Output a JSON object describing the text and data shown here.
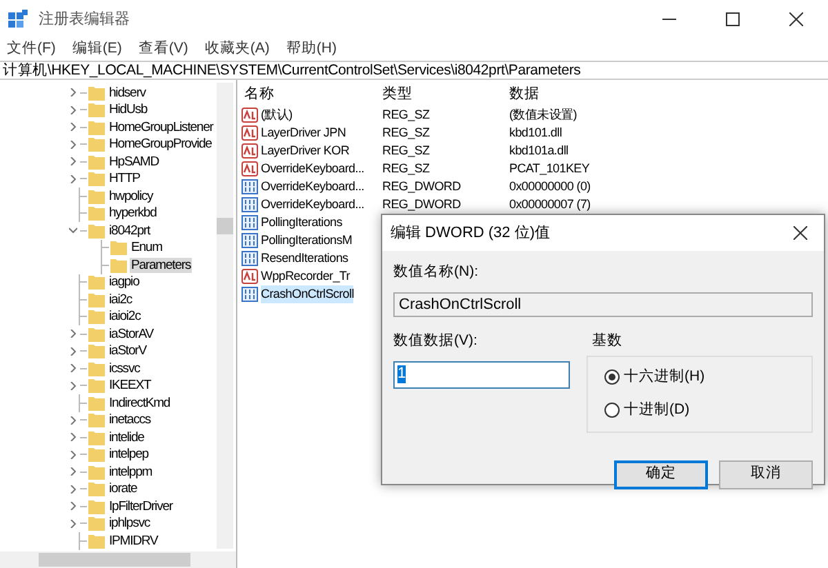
{
  "window": {
    "title": "注册表编辑器"
  },
  "menu": [
    "文件(F)",
    "编辑(E)",
    "查看(V)",
    "收藏夹(A)",
    "帮助(H)"
  ],
  "address": "计算机\\HKEY_LOCAL_MACHINE\\SYSTEM\\CurrentControlSet\\Services\\i8042prt\\Parameters",
  "tree": [
    {
      "label": "hidserv",
      "kind": "collapsed",
      "selected": false
    },
    {
      "label": "HidUsb",
      "kind": "collapsed",
      "selected": false
    },
    {
      "label": "HomeGroupListener",
      "kind": "collapsed",
      "selected": false
    },
    {
      "label": "HomeGroupProvide",
      "kind": "collapsed",
      "selected": false
    },
    {
      "label": "HpSAMD",
      "kind": "collapsed",
      "selected": false
    },
    {
      "label": "HTTP",
      "kind": "collapsed",
      "selected": false
    },
    {
      "label": "hwpolicy",
      "kind": "leaf",
      "selected": false
    },
    {
      "label": "hyperkbd",
      "kind": "leaf",
      "selected": false
    },
    {
      "label": "i8042prt",
      "kind": "expanded",
      "selected": false,
      "children": [
        {
          "label": "Enum",
          "kind": "leaf",
          "selected": false
        },
        {
          "label": "Parameters",
          "kind": "leaf",
          "selected": true
        }
      ]
    },
    {
      "label": "iagpio",
      "kind": "leaf",
      "selected": false
    },
    {
      "label": "iai2c",
      "kind": "leaf",
      "selected": false
    },
    {
      "label": "iaioi2c",
      "kind": "leaf",
      "selected": false
    },
    {
      "label": "iaStorAV",
      "kind": "collapsed",
      "selected": false
    },
    {
      "label": "iaStorV",
      "kind": "collapsed",
      "selected": false
    },
    {
      "label": "icssvc",
      "kind": "collapsed",
      "selected": false
    },
    {
      "label": "IKEEXT",
      "kind": "collapsed",
      "selected": false
    },
    {
      "label": "IndirectKmd",
      "kind": "leaf",
      "selected": false
    },
    {
      "label": "inetaccs",
      "kind": "collapsed",
      "selected": false
    },
    {
      "label": "intelide",
      "kind": "collapsed",
      "selected": false
    },
    {
      "label": "intelpep",
      "kind": "collapsed",
      "selected": false
    },
    {
      "label": "intelppm",
      "kind": "collapsed",
      "selected": false
    },
    {
      "label": "iorate",
      "kind": "collapsed",
      "selected": false
    },
    {
      "label": "IpFilterDriver",
      "kind": "collapsed",
      "selected": false
    },
    {
      "label": "iphlpsvc",
      "kind": "collapsed",
      "selected": false
    },
    {
      "label": "IPMIDRV",
      "kind": "leaf",
      "selected": false
    }
  ],
  "values": {
    "columns": [
      "名称",
      "类型",
      "数据"
    ],
    "rows": [
      {
        "kind": "string",
        "name": "(默认)",
        "type": "REG_SZ",
        "data": "(数值未设置)",
        "selected": false
      },
      {
        "kind": "string",
        "name": "LayerDriver JPN",
        "type": "REG_SZ",
        "data": "kbd101.dll",
        "selected": false
      },
      {
        "kind": "string",
        "name": "LayerDriver KOR",
        "type": "REG_SZ",
        "data": "kbd101a.dll",
        "selected": false
      },
      {
        "kind": "string",
        "name": "OverrideKeyboard...",
        "type": "REG_SZ",
        "data": "PCAT_101KEY",
        "selected": false
      },
      {
        "kind": "binary",
        "name": "OverrideKeyboard...",
        "type": "REG_DWORD",
        "data": "0x00000000 (0)",
        "selected": false
      },
      {
        "kind": "binary",
        "name": "OverrideKeyboard...",
        "type": "REG_DWORD",
        "data": "0x00000007 (7)",
        "selected": false
      },
      {
        "kind": "binary",
        "name": "PollingIterations",
        "selected": false
      },
      {
        "kind": "binary",
        "name": "PollingIterationsM",
        "selected": false
      },
      {
        "kind": "binary",
        "name": "ResendIterations",
        "selected": false
      },
      {
        "kind": "string",
        "name": "WppRecorder_Tr",
        "selected": false
      },
      {
        "kind": "binary",
        "name": "CrashOnCtrlScroll",
        "selected": true
      }
    ]
  },
  "dialog": {
    "title": "编辑 DWORD (32 位)值",
    "name_label": "数值名称(N):",
    "name_value": "CrashOnCtrlScroll",
    "data_label": "数值数据(V):",
    "data_value": "1",
    "base_label": "基数",
    "bases": [
      {
        "label": "十六进制(H)",
        "selected": true
      },
      {
        "label": "十进制(D)",
        "selected": false
      }
    ],
    "buttons": [
      {
        "label": "确定",
        "default": true
      },
      {
        "label": "取消",
        "default": false
      }
    ]
  }
}
